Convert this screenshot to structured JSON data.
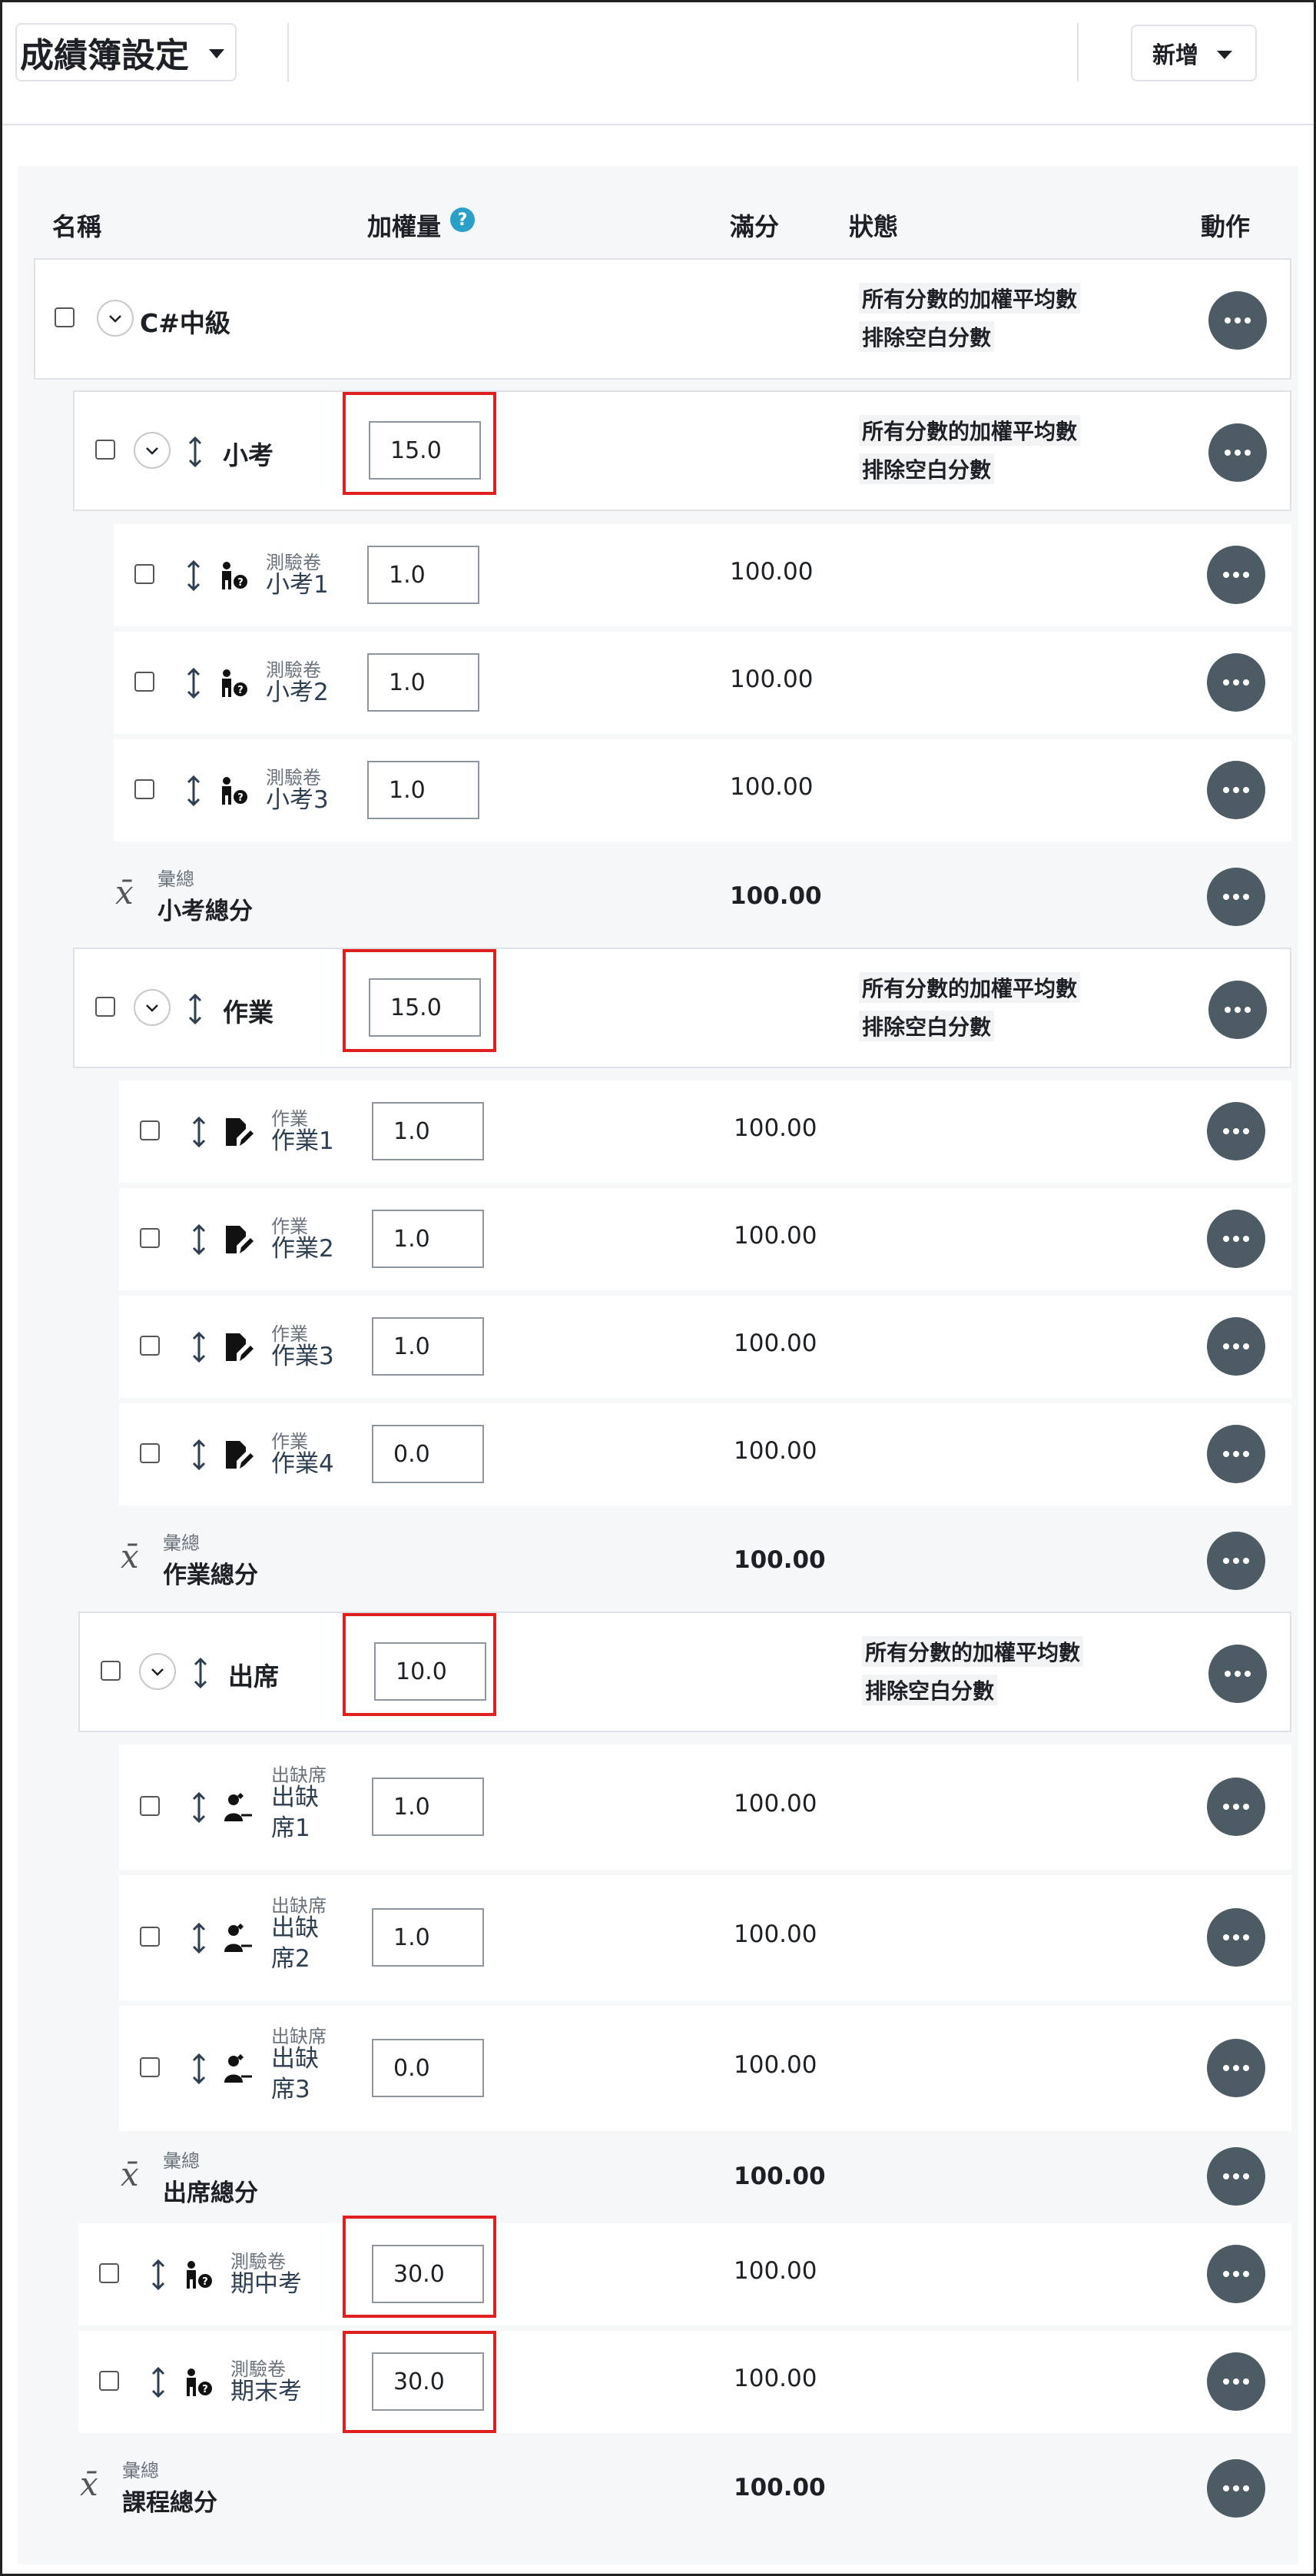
{
  "header": {
    "title": "成績簿設定",
    "add_label": "新增"
  },
  "columns": {
    "name": "名稱",
    "weight": "加權量",
    "max": "滿分",
    "status": "狀態",
    "actions": "動作",
    "help_icon": "?"
  },
  "course": {
    "name": "C#中級",
    "status1": "所有分數的加權平均數",
    "status2": "排除空白分數"
  },
  "cat_quiz": {
    "name": "小考",
    "weight": "15.0",
    "status1": "所有分數的加權平均數",
    "status2": "排除空白分數",
    "items": [
      {
        "type": "測驗卷",
        "name": "小考1",
        "weight": "1.0",
        "max": "100.00"
      },
      {
        "type": "測驗卷",
        "name": "小考2",
        "weight": "1.0",
        "max": "100.00"
      },
      {
        "type": "測驗卷",
        "name": "小考3",
        "weight": "1.0",
        "max": "100.00"
      }
    ],
    "total": {
      "type": "彙總",
      "name": "小考總分",
      "max": "100.00"
    }
  },
  "cat_hw": {
    "name": "作業",
    "weight": "15.0",
    "status1": "所有分數的加權平均數",
    "status2": "排除空白分數",
    "items": [
      {
        "type": "作業",
        "name": "作業1",
        "weight": "1.0",
        "max": "100.00"
      },
      {
        "type": "作業",
        "name": "作業2",
        "weight": "1.0",
        "max": "100.00"
      },
      {
        "type": "作業",
        "name": "作業3",
        "weight": "1.0",
        "max": "100.00"
      },
      {
        "type": "作業",
        "name": "作業4",
        "weight": "0.0",
        "max": "100.00"
      }
    ],
    "total": {
      "type": "彙總",
      "name": "作業總分",
      "max": "100.00"
    }
  },
  "cat_att": {
    "name": "出席",
    "weight": "10.0",
    "status1": "所有分數的加權平均數",
    "status2": "排除空白分數",
    "items": [
      {
        "type": "出缺席",
        "name_l1": "出缺",
        "name_l2": "席1",
        "weight": "1.0",
        "max": "100.00"
      },
      {
        "type": "出缺席",
        "name_l1": "出缺",
        "name_l2": "席2",
        "weight": "1.0",
        "max": "100.00"
      },
      {
        "type": "出缺席",
        "name_l1": "出缺",
        "name_l2": "席3",
        "weight": "0.0",
        "max": "100.00"
      }
    ],
    "total": {
      "type": "彙總",
      "name": "出席總分",
      "max": "100.00"
    }
  },
  "exams": [
    {
      "type": "測驗卷",
      "name": "期中考",
      "weight": "30.0",
      "max": "100.00"
    },
    {
      "type": "測驗卷",
      "name": "期末考",
      "weight": "30.0",
      "max": "100.00"
    }
  ],
  "course_total": {
    "type": "彙總",
    "name": "課程總分",
    "max": "100.00"
  },
  "colors": {
    "action_button": "#4d5c64",
    "highlight": "#e02020",
    "help": "#2aa0c8"
  }
}
